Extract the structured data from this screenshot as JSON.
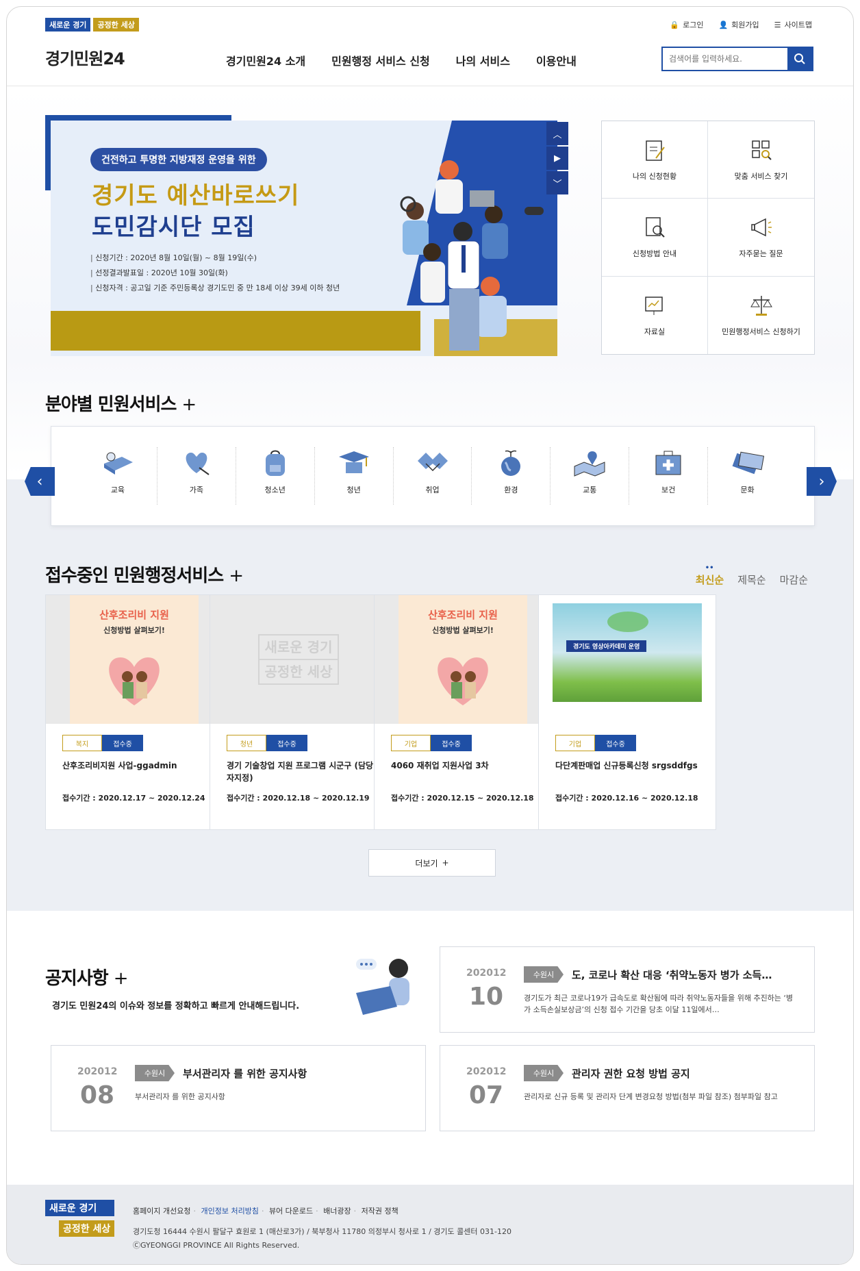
{
  "header": {
    "slogan_1": "새로운 경기",
    "slogan_2": "공정한 세상",
    "util": [
      "로그인",
      "회원가입",
      "사이트맵"
    ],
    "logo": "경기민원24",
    "nav": [
      "경기민원24 소개",
      "민원행정 서비스 신청",
      "나의 서비스",
      "이용안내"
    ],
    "search_placeholder": "검색어를 입력하세요."
  },
  "banner": {
    "pill": "건전하고 투명한 지방재정 운영을 위한",
    "title_1": "경기도 예산바로쓰기",
    "title_2": "도민감시단 모집",
    "info": [
      "신청기간 : 2020년 8월 10일(월) ~ 8월 19일(수)",
      "선정결과발표일 : 2020년 10월 30일(화)",
      "신청자격 : 공고일 기준 주민등록상 경기도민 중 만 18세 이상 39세 이하 청년"
    ]
  },
  "quick_menu": [
    "나의 신청현황",
    "맞춤 서비스 찾기",
    "신청방법 안내",
    "자주묻는 질문",
    "자료실",
    "민원행정서비스 신청하기"
  ],
  "field_section": {
    "title": "분야별 민원서비스",
    "items": [
      "교육",
      "가족",
      "청소년",
      "청년",
      "취업",
      "환경",
      "교통",
      "보건",
      "문화"
    ]
  },
  "receiving_section": {
    "title": "접수중인 민원행정서비스",
    "sort": [
      "최신순",
      "제목순",
      "마감순"
    ],
    "cards": [
      {
        "category": "복지",
        "status": "접수중",
        "title": "산후조리비지원 사업-ggadmin",
        "period": "접수기간 : 2020.12.17 ~ 2020.12.24",
        "thumb_title": "산후조리비 지원",
        "thumb_sub": "신청방법 살펴보기!"
      },
      {
        "category": "청년",
        "status": "접수중",
        "title": "경기 기술창업 지원 프로그램 시군구 (담당자지정)",
        "period": "접수기간 : 2020.12.18 ~ 2020.12.19",
        "thumb_title": "새로운 경기",
        "thumb_sub": "공정한 세상"
      },
      {
        "category": "기업",
        "status": "접수중",
        "title": "4060 재취업 지원사업 3차",
        "period": "접수기간 : 2020.12.15 ~ 2020.12.18",
        "thumb_title": "산후조리비 지원",
        "thumb_sub": "신청방법 살펴보기!"
      },
      {
        "category": "기업",
        "status": "접수중",
        "title": "다단계판매업 신규등록신청 srgsddfgs",
        "period": "접수기간 : 2020.12.16 ~ 2020.12.18",
        "thumb_title": "경기도 영상아카데미 운영",
        "thumb_sub": ""
      }
    ],
    "more": "더보기"
  },
  "notice_section": {
    "title": "공지사항",
    "desc": "경기도 민원24의 이슈와 정보를 정확하고 빠르게 안내해드립니다.",
    "items": [
      {
        "ym": "202012",
        "day": "10",
        "cat": "수원시",
        "title": "도, 코로나 확산 대응 ‘취약노동자 병가 소득…",
        "desc": "경기도가 최근 코로나19가 급속도로 확산됨에 따라 취약노동자들을 위해 추진하는 ‘병가 소득손실보상금’의 신청 접수 기간을 당초 이달 11일에서…"
      },
      {
        "ym": "202012",
        "day": "08",
        "cat": "수원시",
        "title": "부서관리자 를 위한 공지사항",
        "desc": "부서관리자 를 위한 공지사항"
      },
      {
        "ym": "202012",
        "day": "07",
        "cat": "수원시",
        "title": "관리자 권한 요청 방법 공지",
        "desc": "관리자로 신규 등록 및 관리자 단계 변경요청 방법(첨부 파일 참조) 첨부파일 참고"
      }
    ]
  },
  "footer": {
    "logo_1": "새로운 경기",
    "logo_2": "공정한 세상",
    "links": [
      "홈페이지 개선요청",
      "개인정보 처리방침",
      "뷰어 다운로드",
      "배너광장",
      "저작권 정책"
    ],
    "address": "경기도청 16444 수원시 팔달구 효원로 1 (매산로3가) / 북부청사 11780 의정부시 청사로 1 / 경기도 콜센터 031-120",
    "copyright": "ⒸGYEONGGI PROVINCE All Rights Reserved."
  },
  "colors": {
    "primary": "#1f4fa5",
    "gold": "#c39c1b",
    "gray_bg": "#eceff4"
  }
}
